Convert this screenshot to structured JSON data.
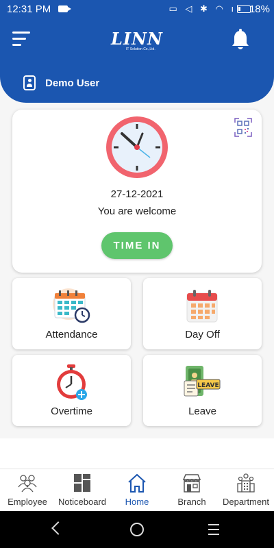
{
  "status_bar": {
    "time": "12:31 PM",
    "battery": "18%"
  },
  "header": {
    "brand": "LINN",
    "brand_subtitle": "IT Solution Co.,Ltd.",
    "user_name": "Demo User",
    "color": "#1b56b0"
  },
  "clock_card": {
    "date": "27-12-2021",
    "message": "You are welcome",
    "button_label": "TIME IN",
    "button_color": "#5fc56d"
  },
  "menu_tiles": [
    {
      "label": "Attendance",
      "icon": "attendance-calendar-icon"
    },
    {
      "label": "Day Off",
      "icon": "day-off-calendar-icon"
    },
    {
      "label": "Overtime",
      "icon": "overtime-stopwatch-icon"
    },
    {
      "label": "Leave",
      "icon": "leave-icon"
    }
  ],
  "bottom_nav": {
    "items": [
      {
        "label": "Employee",
        "icon": "employee-icon"
      },
      {
        "label": "Noticeboard",
        "icon": "noticeboard-icon"
      },
      {
        "label": "Home",
        "icon": "home-icon",
        "active": true
      },
      {
        "label": "Branch",
        "icon": "branch-icon"
      },
      {
        "label": "Department",
        "icon": "department-icon"
      }
    ]
  }
}
